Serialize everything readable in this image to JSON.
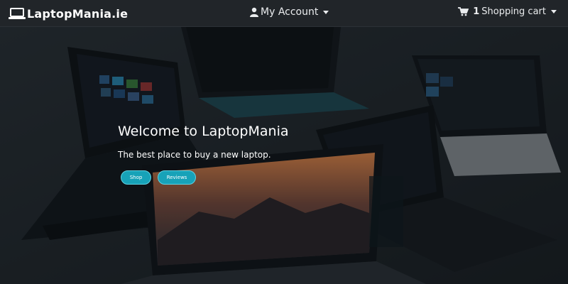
{
  "navbar": {
    "brand": "LaptopMania.ie",
    "brand_icon": "laptop-icon",
    "account_label": "My Account",
    "account_icon": "user-icon",
    "cart_count": "1",
    "cart_label": "Shopping cart",
    "cart_icon": "cart-icon"
  },
  "hero": {
    "title": "Welcome to LaptopMania",
    "subtitle": "The best place to buy a new laptop.",
    "buttons": [
      {
        "label": "Shop"
      },
      {
        "label": "Reviews"
      }
    ]
  },
  "colors": {
    "navbar_bg": "#212529",
    "button_bg": "#17a2b8",
    "text": "#ffffff"
  }
}
